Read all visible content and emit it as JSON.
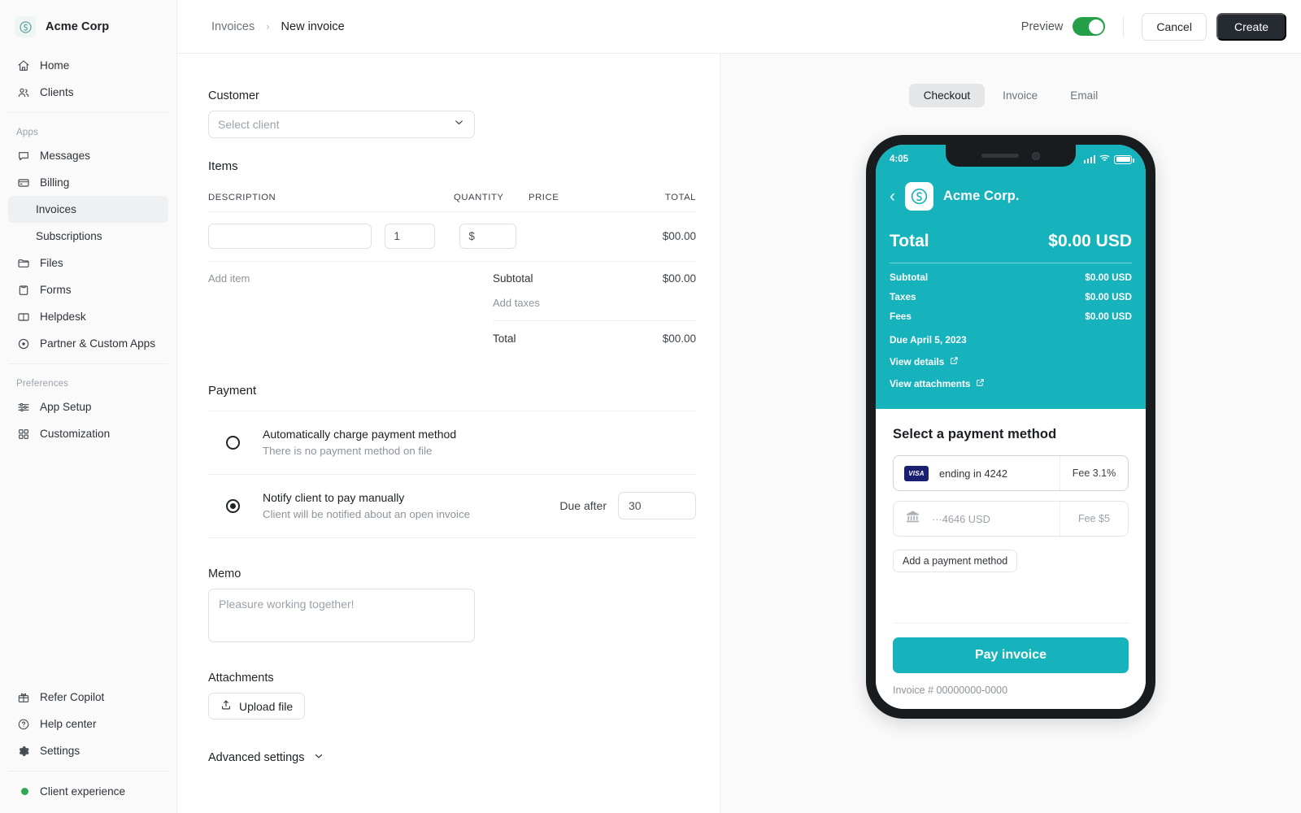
{
  "sidebar": {
    "brand": {
      "name": "Acme Corp",
      "logo_icon": "acme-swirl-logo"
    },
    "primary": [
      {
        "label": "Home",
        "icon": "home-icon"
      },
      {
        "label": "Clients",
        "icon": "users-icon"
      }
    ],
    "apps_label": "Apps",
    "apps": [
      {
        "label": "Messages",
        "icon": "chat-bubble-icon"
      },
      {
        "label": "Billing",
        "icon": "credit-card-icon"
      }
    ],
    "billing_children": [
      {
        "label": "Invoices",
        "active": true
      },
      {
        "label": "Subscriptions",
        "active": false
      }
    ],
    "apps_rest": [
      {
        "label": "Files",
        "icon": "folder-icon"
      },
      {
        "label": "Forms",
        "icon": "clipboard-icon"
      },
      {
        "label": "Helpdesk",
        "icon": "book-icon"
      },
      {
        "label": "Partner & Custom Apps",
        "icon": "target-icon"
      }
    ],
    "preferences_label": "Preferences",
    "preferences": [
      {
        "label": "App Setup",
        "icon": "sliders-icon"
      },
      {
        "label": "Customization",
        "icon": "grid-icon"
      }
    ],
    "footer": [
      {
        "label": "Refer Copilot",
        "icon": "gift-icon"
      },
      {
        "label": "Help center",
        "icon": "question-circle-icon"
      },
      {
        "label": "Settings",
        "icon": "gear-icon"
      }
    ],
    "client_experience": {
      "label": "Client experience",
      "status_color": "#2eaa52"
    }
  },
  "topbar": {
    "breadcrumb_root": "Invoices",
    "breadcrumb_sep": "›",
    "breadcrumb_current": "New invoice",
    "preview_label": "Preview",
    "preview_on": true,
    "toggle_color": "#24a148",
    "cancel_label": "Cancel",
    "create_label": "Create"
  },
  "form": {
    "customer": {
      "label": "Customer",
      "placeholder": "Select client",
      "chevron": "chevron-down-icon"
    },
    "items": {
      "title": "Items",
      "columns": [
        "DESCRIPTION",
        "QUANTITY",
        "PRICE",
        "TOTAL"
      ],
      "row": {
        "description": "",
        "quantity": "1",
        "price": "$",
        "total": "$00.00"
      },
      "add_item_label": "Add item",
      "subtotal_label": "Subtotal",
      "subtotal_value": "$00.00",
      "add_taxes_label": "Add taxes",
      "total_label": "Total",
      "total_value": "$00.00"
    },
    "payment": {
      "title": "Payment",
      "option_auto": {
        "title": "Automatically charge payment method",
        "subtitle": "There is no payment method on file",
        "selected": false
      },
      "option_manual": {
        "title": "Notify client to pay manually",
        "subtitle": "Client will be notified about an open invoice",
        "selected": true
      },
      "due_after_label": "Due after",
      "due_after_value": "30"
    },
    "memo": {
      "label": "Memo",
      "placeholder": "Pleasure working together!"
    },
    "attachments": {
      "label": "Attachments",
      "upload_label": "Upload file",
      "upload_icon": "upload-icon"
    },
    "advanced": {
      "label": "Advanced settings",
      "icon": "chevron-down-icon"
    }
  },
  "preview": {
    "tabs": [
      {
        "label": "Checkout",
        "active": true
      },
      {
        "label": "Invoice",
        "active": false
      },
      {
        "label": "Email",
        "active": false
      }
    ],
    "phone": {
      "status_time": "4:05",
      "status_icons": [
        "signal-bars-icon",
        "wifi-icon",
        "battery-icon"
      ],
      "brand_name": "Acme Corp.",
      "back_icon": "chevron-left-icon",
      "logo_icon": "acme-swirl-logo",
      "accent_color": "#17b3bd",
      "total_label": "Total",
      "total_value": "$0.00 USD",
      "summary": [
        {
          "label": "Subtotal",
          "value": "$0.00 USD"
        },
        {
          "label": "Taxes",
          "value": "$0.00 USD"
        },
        {
          "label": "Fees",
          "value": "$0.00 USD"
        }
      ],
      "due_text": "Due April 5, 2023",
      "links": [
        {
          "label": "View details",
          "icon": "external-link-icon"
        },
        {
          "label": "View attachments",
          "icon": "external-link-icon"
        }
      ],
      "payment_title": "Select a payment method",
      "methods": [
        {
          "icon": "visa-card-icon",
          "badge": "VISA",
          "label": "ending in 4242",
          "fee": "Fee 3.1%",
          "selected": true
        },
        {
          "icon": "bank-icon",
          "badge": "",
          "label": "···4646 USD",
          "fee": "Fee $5",
          "selected": false
        }
      ],
      "add_method_label": "Add a payment method",
      "pay_button_label": "Pay invoice",
      "invoice_number": "Invoice # 00000000-0000"
    }
  }
}
